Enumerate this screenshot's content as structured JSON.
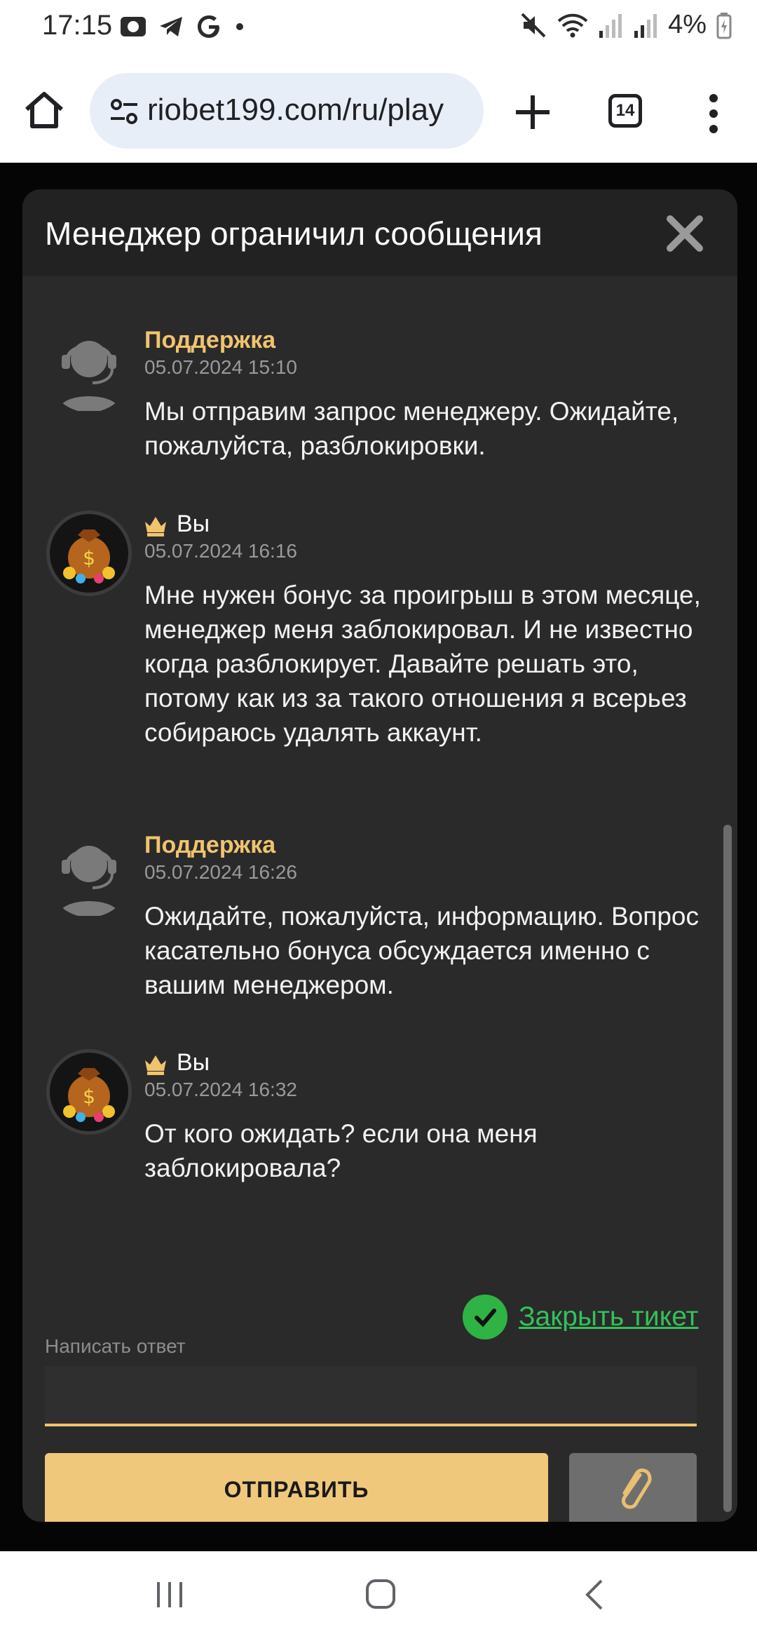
{
  "status_bar": {
    "time": "17:15",
    "battery": "4%",
    "icons_left": [
      "vpn-icon",
      "telegram-icon",
      "google-icon",
      "dot-icon"
    ],
    "icons_right": [
      "mute-icon",
      "wifi-icon",
      "signal-icon",
      "signal-icon",
      "battery-charging-icon"
    ]
  },
  "browser": {
    "url": "riobet199.com/ru/play",
    "tab_count": "14"
  },
  "modal": {
    "title": "Менеджер ограничил сообщения",
    "messages": [
      {
        "author": "Поддержка",
        "date": "05.07.2024 15:10",
        "text": "Мы отправим запрос менеджеру. Ожидайте, пожалуйста, разблокировки.",
        "role": "support"
      },
      {
        "author": "Вы",
        "date": "05.07.2024 16:16",
        "text": "Мне нужен бонус за проигрыш в этом месяце, менеджер меня заблокировал. И не известно когда разблокирует. Давайте решать это, потому как из за такого отношения я всерьез собираюсь удалять аккаунт.",
        "role": "user"
      },
      {
        "author": "Поддержка",
        "date": "05.07.2024 16:26",
        "text": "Ожидайте, пожалуйста, информацию. Вопрос касательно бонуса обсуждается именно с вашим менеджером.",
        "role": "support"
      },
      {
        "author": "Вы",
        "date": "05.07.2024 16:32",
        "text": "От кого ожидать? если она меня заблокировала?",
        "role": "user"
      }
    ],
    "close_ticket": "Закрыть тикет",
    "reply_label": "Написать ответ",
    "reply_value": "",
    "send_label": "ОТПРАВИТЬ"
  },
  "colors": {
    "accent": "#f0c87c",
    "support_name": "#f0c36e",
    "close_ticket": "#33c15a",
    "modal_bg": "#2a2a2a"
  }
}
